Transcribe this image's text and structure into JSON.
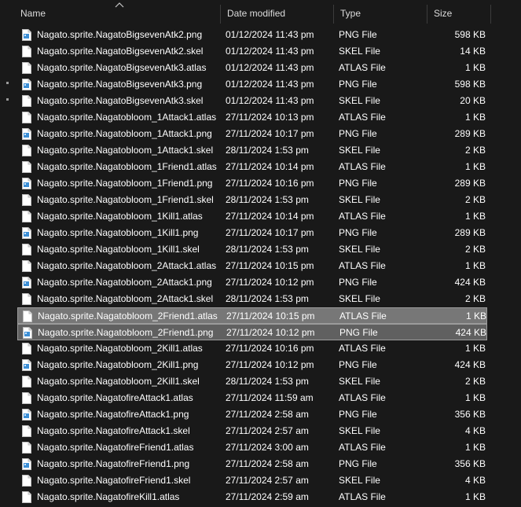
{
  "columns": {
    "name": "Name",
    "date": "Date modified",
    "type": "Type",
    "size": "Size"
  },
  "files": [
    {
      "name": "Nagato.sprite.NagatoBigsevenAtk2.png",
      "date": "01/12/2024 11:43 pm",
      "type": "PNG File",
      "size": "598 KB",
      "icon": "png-image-icon"
    },
    {
      "name": "Nagato.sprite.NagatoBigsevenAtk2.skel",
      "date": "01/12/2024 11:43 pm",
      "type": "SKEL File",
      "size": "14 KB",
      "icon": "generic-file-icon"
    },
    {
      "name": "Nagato.sprite.NagatoBigsevenAtk3.atlas",
      "date": "01/12/2024 11:43 pm",
      "type": "ATLAS File",
      "size": "1 KB",
      "icon": "generic-file-icon"
    },
    {
      "name": "Nagato.sprite.NagatoBigsevenAtk3.png",
      "date": "01/12/2024 11:43 pm",
      "type": "PNG File",
      "size": "598 KB",
      "icon": "png-image-icon"
    },
    {
      "name": "Nagato.sprite.NagatoBigsevenAtk3.skel",
      "date": "01/12/2024 11:43 pm",
      "type": "SKEL File",
      "size": "20 KB",
      "icon": "generic-file-icon"
    },
    {
      "name": "Nagato.sprite.Nagatobloom_1Attack1.atlas",
      "date": "27/11/2024 10:13 pm",
      "type": "ATLAS File",
      "size": "1 KB",
      "icon": "generic-file-icon"
    },
    {
      "name": "Nagato.sprite.Nagatobloom_1Attack1.png",
      "date": "27/11/2024 10:17 pm",
      "type": "PNG File",
      "size": "289 KB",
      "icon": "png-image-icon"
    },
    {
      "name": "Nagato.sprite.Nagatobloom_1Attack1.skel",
      "date": "28/11/2024 1:53 pm",
      "type": "SKEL File",
      "size": "2 KB",
      "icon": "generic-file-icon"
    },
    {
      "name": "Nagato.sprite.Nagatobloom_1Friend1.atlas",
      "date": "27/11/2024 10:14 pm",
      "type": "ATLAS File",
      "size": "1 KB",
      "icon": "generic-file-icon"
    },
    {
      "name": "Nagato.sprite.Nagatobloom_1Friend1.png",
      "date": "27/11/2024 10:16 pm",
      "type": "PNG File",
      "size": "289 KB",
      "icon": "png-image-icon"
    },
    {
      "name": "Nagato.sprite.Nagatobloom_1Friend1.skel",
      "date": "28/11/2024 1:53 pm",
      "type": "SKEL File",
      "size": "2 KB",
      "icon": "generic-file-icon"
    },
    {
      "name": "Nagato.sprite.Nagatobloom_1Kill1.atlas",
      "date": "27/11/2024 10:14 pm",
      "type": "ATLAS File",
      "size": "1 KB",
      "icon": "generic-file-icon"
    },
    {
      "name": "Nagato.sprite.Nagatobloom_1Kill1.png",
      "date": "27/11/2024 10:17 pm",
      "type": "PNG File",
      "size": "289 KB",
      "icon": "png-image-icon"
    },
    {
      "name": "Nagato.sprite.Nagatobloom_1Kill1.skel",
      "date": "28/11/2024 1:53 pm",
      "type": "SKEL File",
      "size": "2 KB",
      "icon": "generic-file-icon"
    },
    {
      "name": "Nagato.sprite.Nagatobloom_2Attack1.atlas",
      "date": "27/11/2024 10:15 pm",
      "type": "ATLAS File",
      "size": "1 KB",
      "icon": "generic-file-icon"
    },
    {
      "name": "Nagato.sprite.Nagatobloom_2Attack1.png",
      "date": "27/11/2024 10:12 pm",
      "type": "PNG File",
      "size": "424 KB",
      "icon": "png-image-icon"
    },
    {
      "name": "Nagato.sprite.Nagatobloom_2Attack1.skel",
      "date": "28/11/2024 1:53 pm",
      "type": "SKEL File",
      "size": "2 KB",
      "icon": "generic-file-icon"
    },
    {
      "name": "Nagato.sprite.Nagatobloom_2Friend1.atlas",
      "date": "27/11/2024 10:15 pm",
      "type": "ATLAS File",
      "size": "1 KB",
      "icon": "generic-file-icon",
      "selected": true
    },
    {
      "name": "Nagato.sprite.Nagatobloom_2Friend1.png",
      "date": "27/11/2024 10:12 pm",
      "type": "PNG File",
      "size": "424 KB",
      "icon": "png-image-icon",
      "selected": true
    },
    {
      "name": "Nagato.sprite.Nagatobloom_2Kill1.atlas",
      "date": "27/11/2024 10:16 pm",
      "type": "ATLAS File",
      "size": "1 KB",
      "icon": "generic-file-icon"
    },
    {
      "name": "Nagato.sprite.Nagatobloom_2Kill1.png",
      "date": "27/11/2024 10:12 pm",
      "type": "PNG File",
      "size": "424 KB",
      "icon": "png-image-icon"
    },
    {
      "name": "Nagato.sprite.Nagatobloom_2Kill1.skel",
      "date": "28/11/2024 1:53 pm",
      "type": "SKEL File",
      "size": "2 KB",
      "icon": "generic-file-icon"
    },
    {
      "name": "Nagato.sprite.NagatofireAttack1.atlas",
      "date": "27/11/2024 11:59 am",
      "type": "ATLAS File",
      "size": "1 KB",
      "icon": "generic-file-icon"
    },
    {
      "name": "Nagato.sprite.NagatofireAttack1.png",
      "date": "27/11/2024 2:58 am",
      "type": "PNG File",
      "size": "356 KB",
      "icon": "png-image-icon"
    },
    {
      "name": "Nagato.sprite.NagatofireAttack1.skel",
      "date": "27/11/2024 2:57 am",
      "type": "SKEL File",
      "size": "4 KB",
      "icon": "generic-file-icon"
    },
    {
      "name": "Nagato.sprite.NagatofireFriend1.atlas",
      "date": "27/11/2024 3:00 am",
      "type": "ATLAS File",
      "size": "1 KB",
      "icon": "generic-file-icon"
    },
    {
      "name": "Nagato.sprite.NagatofireFriend1.png",
      "date": "27/11/2024 2:58 am",
      "type": "PNG File",
      "size": "356 KB",
      "icon": "png-image-icon"
    },
    {
      "name": "Nagato.sprite.NagatofireFriend1.skel",
      "date": "27/11/2024 2:57 am",
      "type": "SKEL File",
      "size": "4 KB",
      "icon": "generic-file-icon"
    },
    {
      "name": "Nagato.sprite.NagatofireKill1.atlas",
      "date": "27/11/2024 2:59 am",
      "type": "ATLAS File",
      "size": "1 KB",
      "icon": "generic-file-icon"
    }
  ],
  "colors": {
    "background": "#191919",
    "text": "#ffffff",
    "selected_row": "#777777",
    "png_icon_accent": "#3d8fd6"
  }
}
